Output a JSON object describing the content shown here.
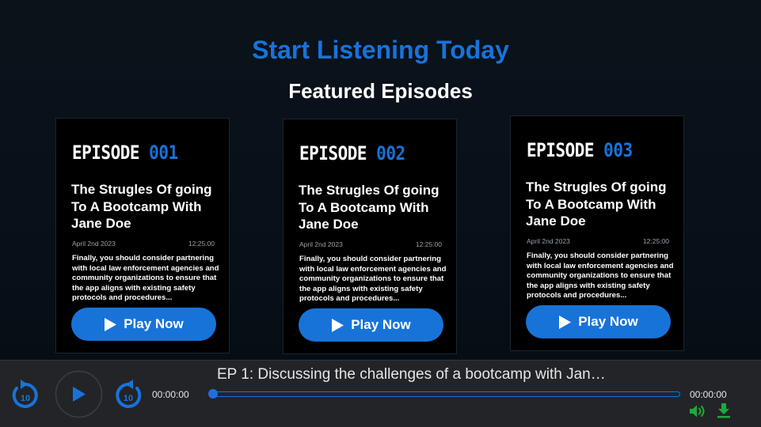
{
  "hero": {
    "title": "Start Listening Today"
  },
  "section": {
    "title": "Featured Episodes"
  },
  "episodes": [
    {
      "label": "EPISODE",
      "number": "001",
      "title": "The Strugles Of going To A Bootcamp With Jane Doe",
      "date": "April 2nd 2023",
      "duration": "12:25:00",
      "description": "Finally, you should consider partnering with local law enforcement agencies and community organizations to ensure that the app aligns with existing safety protocols and procedures...",
      "button_label": "Play Now"
    },
    {
      "label": "EPISODE",
      "number": "002",
      "title": "The Strugles Of going To A Bootcamp With Jane Doe",
      "date": "April 2nd 2023",
      "duration": "12:25:00",
      "description": "Finally, you should consider partnering with local law enforcement agencies and community organizations to ensure that the app aligns with existing safety protocols and procedures...",
      "button_label": "Play Now"
    },
    {
      "label": "EPISODE",
      "number": "003",
      "title": "The Strugles Of going To A Bootcamp With Jane Doe",
      "date": "April 2nd 2023",
      "duration": "12:25:00",
      "description": "Finally, you should consider partnering with local law enforcement agencies and community organizations to ensure that the app aligns with existing safety protocols and procedures...",
      "button_label": "Play Now"
    }
  ],
  "player": {
    "now_playing": "EP 1: Discussing the challenges of a bootcamp with Jan…",
    "current_time": "00:00:00",
    "end_time": "00:00:00",
    "skip_seconds": "10",
    "progress": 0,
    "icons": {
      "rewind": "rewind-10-icon",
      "play": "play-icon",
      "forward": "forward-10-icon",
      "volume": "volume-icon",
      "download": "download-icon"
    }
  },
  "colors": {
    "accent": "#1873d9",
    "background": "#071019",
    "card": "#000000",
    "player_bar": "#232427",
    "icon_green": "#1ea83c"
  }
}
